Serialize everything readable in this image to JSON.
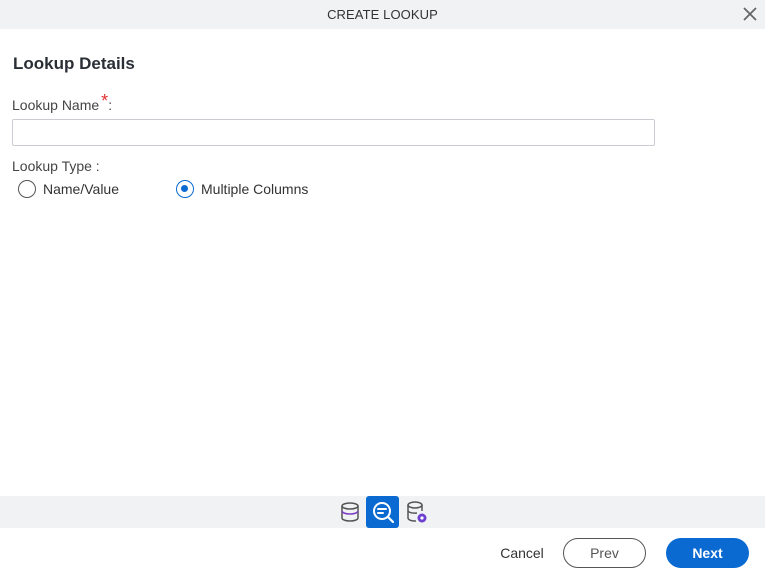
{
  "dialog": {
    "title": "CREATE LOOKUP",
    "close_icon": "close-icon"
  },
  "form": {
    "section_title": "Lookup Details",
    "lookup_name": {
      "label": "Lookup Name",
      "required_marker": "*",
      "suffix": ":",
      "value": "",
      "placeholder": ""
    },
    "lookup_type": {
      "label": "Lookup Type :",
      "options": [
        {
          "label": "Name/Value",
          "selected": false
        },
        {
          "label": "Multiple Columns",
          "selected": true
        }
      ]
    }
  },
  "toolbar": {
    "items": [
      {
        "icon": "database-icon",
        "active": false
      },
      {
        "icon": "search-list-icon",
        "active": true
      },
      {
        "icon": "database-settings-icon",
        "active": false
      }
    ]
  },
  "footer": {
    "cancel_label": "Cancel",
    "prev_label": "Prev",
    "next_label": "Next"
  },
  "colors": {
    "accent": "#0a6ad1",
    "required": "#e0312f",
    "header_bg": "#f1f2f4"
  }
}
